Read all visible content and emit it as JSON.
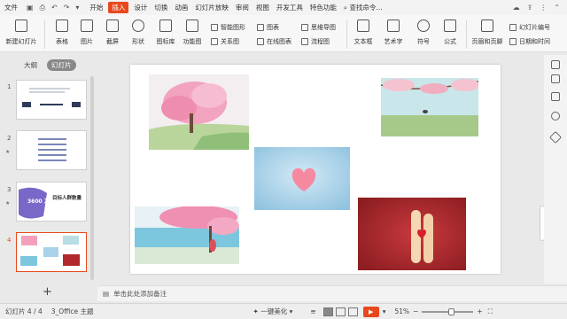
{
  "menu": {
    "file": "文件",
    "tabs": [
      "开始",
      "插入",
      "设计",
      "切换",
      "动画",
      "幻灯片放映",
      "审阅",
      "视图",
      "开发工具",
      "特色功能"
    ],
    "active_tab": "插入",
    "search": "查找命令...",
    "quick_access": [
      "undo-icon",
      "redo-icon",
      "save-icon",
      "print-icon"
    ]
  },
  "ribbon": {
    "new_slide": "新建幻灯片",
    "table": "表格",
    "picture": "图片",
    "screenshot": "截屏",
    "shape": "形状",
    "icon_lib": "图标库",
    "func_graph": "功能图",
    "smart_art": "智能图形",
    "relation_graph": "关系图",
    "chart": "图表",
    "online_chart": "在线图表",
    "mind_map": "思维导图",
    "flowchart": "流程图",
    "textbox": "文本框",
    "wordart": "艺术字",
    "symbol": "符号",
    "formula": "公式",
    "header_footer": "页眉和页脚",
    "slide_number": "幻灯片编号",
    "date_time": "日期和时间"
  },
  "left_pane": {
    "outline_tab": "大纲",
    "slides_tab": "幻灯片",
    "slides": [
      {
        "num": "1",
        "has_star": false
      },
      {
        "num": "2",
        "has_star": true
      },
      {
        "num": "3",
        "has_star": true,
        "text": "3600 万",
        "title": "目标人群数量"
      },
      {
        "num": "4",
        "has_star": false,
        "selected": true
      }
    ],
    "add_slide": "+"
  },
  "slide": {
    "pictures": [
      {
        "name": "pink-cherry-tree-landscape",
        "colors": [
          "#f3a0bd",
          "#dff0ea",
          "#a8c78c"
        ]
      },
      {
        "name": "cherry-branch-with-bird",
        "colors": [
          "#f5c3cf",
          "#b8dde4",
          "#9cc08a"
        ]
      },
      {
        "name": "heart-shape-on-blue",
        "colors": [
          "#a9d2ea",
          "#f589a0"
        ]
      },
      {
        "name": "girl-under-cherry-tree-seaside",
        "colors": [
          "#ef8fb2",
          "#7dc7de",
          "#e9f2f5"
        ]
      },
      {
        "name": "finger-couple-with-heart",
        "colors": [
          "#b2282d",
          "#f6d7b4"
        ]
      }
    ]
  },
  "notes": {
    "placeholder": "单击此处添加备注"
  },
  "status": {
    "slide_info": "幻灯片 4 / 4",
    "theme": "3_Office 主题",
    "beautify": "一键美化",
    "zoom": "51%"
  },
  "colors": {
    "accent": "#e8481c"
  }
}
